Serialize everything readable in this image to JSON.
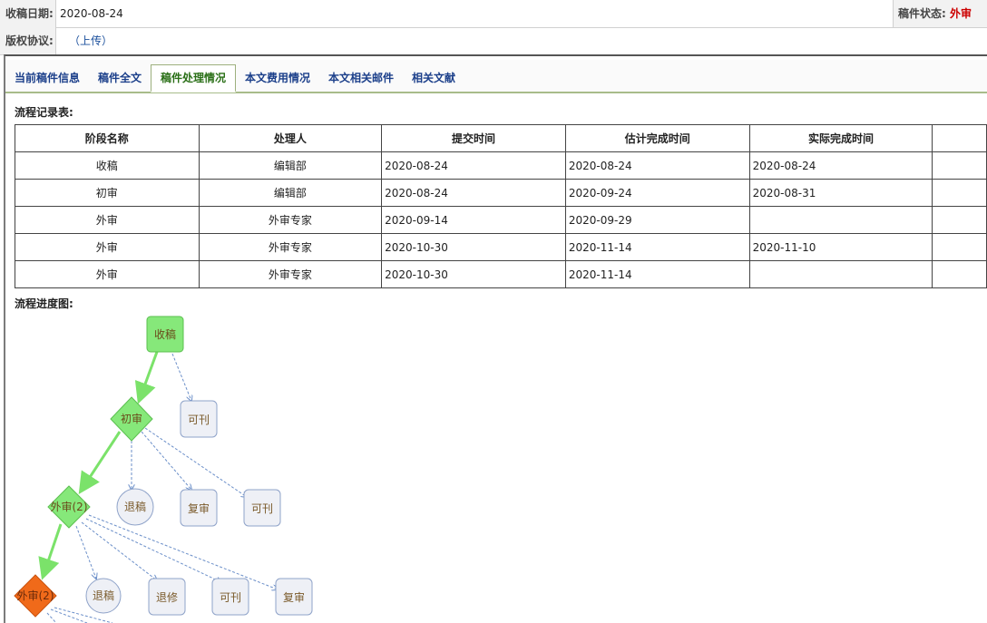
{
  "info": {
    "date_label": "收稿日期:",
    "date_value": "2020-08-24",
    "copyright_label": "版权协议:",
    "copyright_value": "（上传）",
    "status_label": "稿件状态: ",
    "status_value": "外审"
  },
  "tabs": [
    {
      "label": "当前稿件信息"
    },
    {
      "label": "稿件全文"
    },
    {
      "label": "稿件处理情况"
    },
    {
      "label": "本文费用情况"
    },
    {
      "label": "本文相关邮件"
    },
    {
      "label": "相关文献"
    }
  ],
  "records": {
    "title": "流程记录表:",
    "headers": [
      "阶段名称",
      "处理人",
      "提交时间",
      "估计完成时间",
      "实际完成时间"
    ],
    "rows": [
      [
        "收稿",
        "编辑部",
        "2020-08-24",
        "2020-08-24",
        "2020-08-24"
      ],
      [
        "初审",
        "编辑部",
        "2020-08-24",
        "2020-09-24",
        "2020-08-31"
      ],
      [
        "外审",
        "外审专家",
        "2020-09-14",
        "2020-09-29",
        ""
      ],
      [
        "外审",
        "外审专家",
        "2020-10-30",
        "2020-11-14",
        "2020-11-10"
      ],
      [
        "外审",
        "外审专家",
        "2020-10-30",
        "2020-11-14",
        ""
      ]
    ]
  },
  "flow": {
    "title": "流程进度图:",
    "nodes": {
      "receive": "收稿",
      "initial": "初审",
      "publishable_1": "可刊",
      "external_1": "外审(2)",
      "reject_1": "退稿",
      "re_review_1": "复审",
      "publishable_2": "可刊",
      "external_2": "外审(2)",
      "reject_2": "退稿",
      "revise": "退修",
      "publishable_3": "可刊",
      "re_review_2": "复审"
    },
    "colors": {
      "done": "#86e87a",
      "current": "#f06a1a",
      "pending": "#eef0f6",
      "arrow_done": "#7be26a",
      "arrow_option": "#6b8fc9"
    }
  }
}
